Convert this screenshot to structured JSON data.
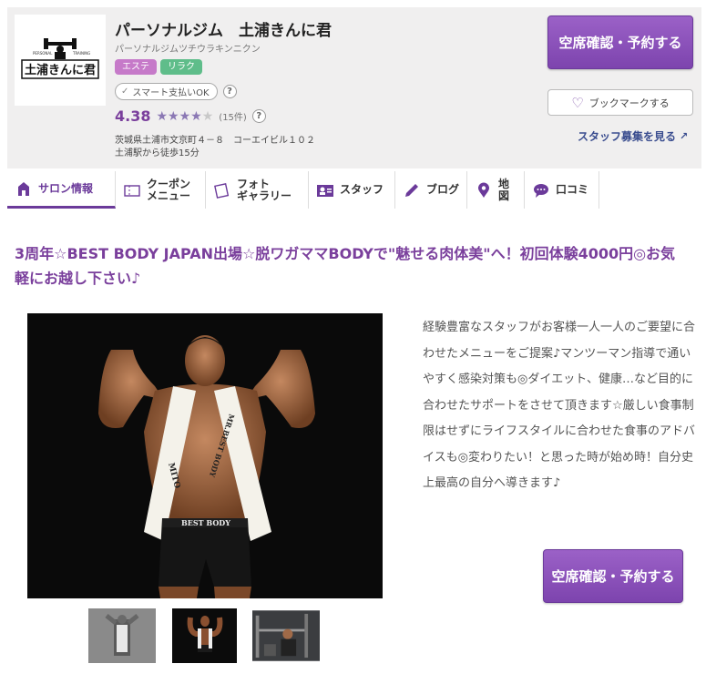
{
  "header": {
    "logo_text": "土浦きんに君",
    "logo_sub_left": "PERSONAL",
    "logo_sub_right": "TRAINING",
    "salon_name": "パーソナルジム　土浦きんに君",
    "salon_kana": "パーソナルジムツチウラキンニクン",
    "tags": [
      "エステ",
      "リラク"
    ],
    "smart_pay": "スマート支払いOK",
    "help": "?",
    "rating": "4.38",
    "stars_filled": 4,
    "review_count": "(15件)",
    "address_line1": "茨城県土浦市文京町４－８　コーエイビル１０２",
    "address_line2": "土浦駅から徒歩15分",
    "reserve_label": "空席確認・予約する",
    "bookmark_label": "ブックマークする",
    "staff_recruit": "スタッフ募集を見る"
  },
  "tabs": [
    {
      "label": "サロン情報",
      "icon": "home-icon",
      "active": true
    },
    {
      "label": "クーポン\nメニュー",
      "icon": "coupon-icon"
    },
    {
      "label": "フォト\nギャラリー",
      "icon": "photo-icon"
    },
    {
      "label": "スタッフ",
      "icon": "staff-icon"
    },
    {
      "label": "ブログ",
      "icon": "pencil-icon"
    },
    {
      "label": "地図",
      "icon": "map-pin-icon"
    },
    {
      "label": "口コミ",
      "icon": "chat-icon"
    }
  ],
  "catch_copy": "3周年☆BEST BODY JAPAN出場☆脱ワガママBODYで\"魅せる肉体美\"へ！初回体験4000円◎お気軽にお越し下さい♪",
  "photo_text": {
    "sash_left": "MITO",
    "sash_right": "MR.BEST BODY",
    "shorts": "BEST BODY"
  },
  "description": "経験豊富なスタッフがお客様一人一人のご要望に合わせたメニューをご提案♪マンツーマン指導で通いやすく感染対策も◎ダイエット、健康…など目的に合わせたサポートをさせて頂きます☆厳しい食事制限はせずにライフスタイルに合わせた食事のアドバイスも◎変わりたい！と思った時が始め時！自分史上最高の自分へ導きます♪",
  "reserve_bottom_label": "空席確認・予約する",
  "colors": {
    "accent": "#7a3f9c",
    "button": "#8a52b8",
    "tag_esthe": "#c67ac9",
    "tag_relax": "#5fbd8a",
    "header_bg": "#f0efef"
  }
}
